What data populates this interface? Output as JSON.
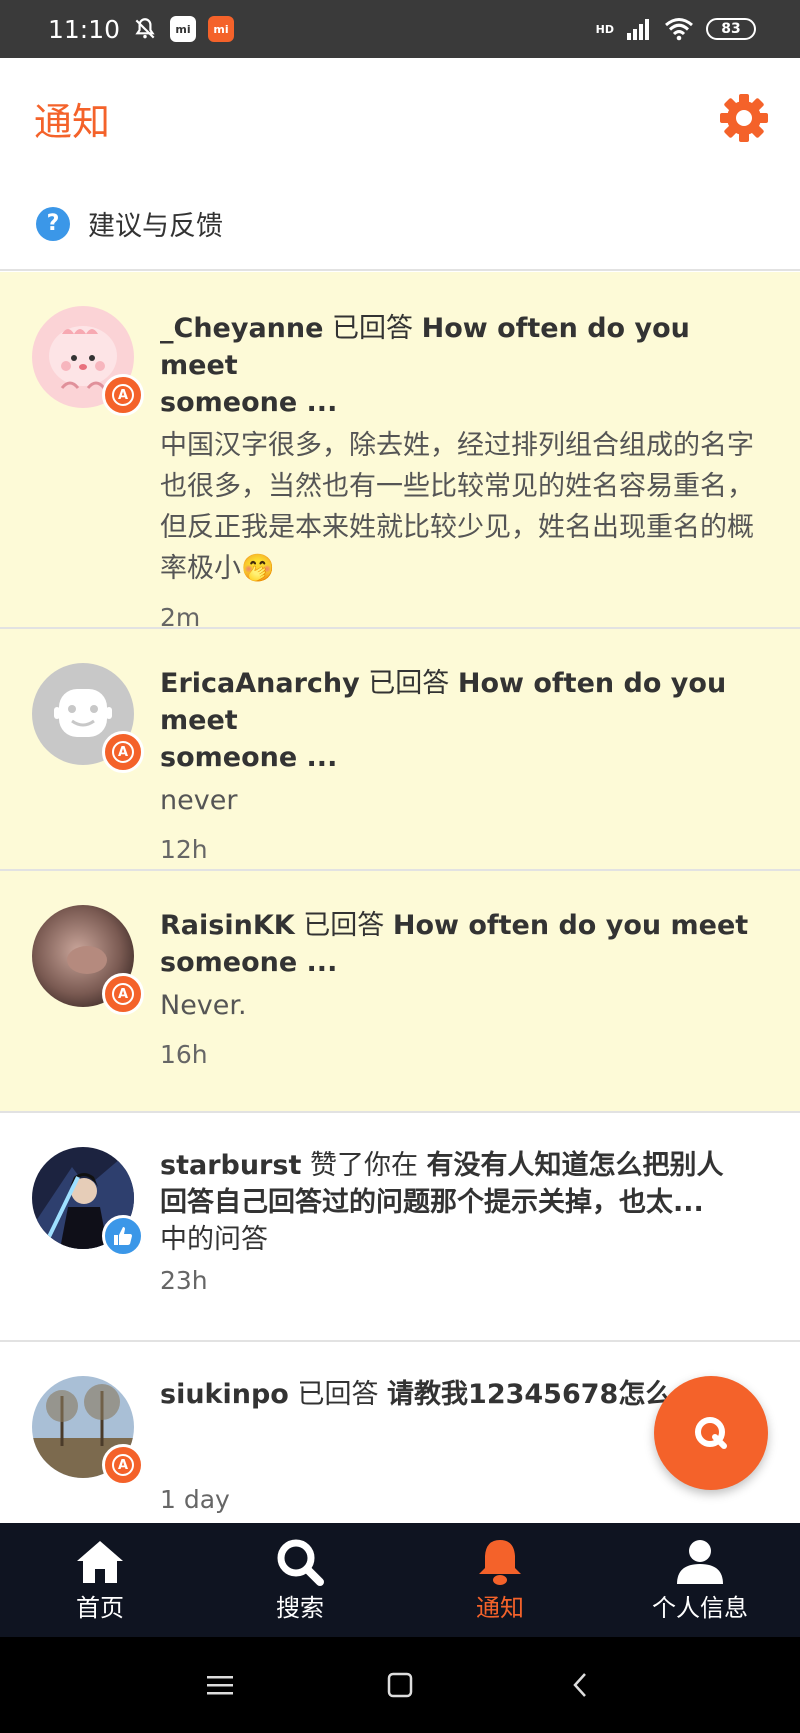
{
  "status_bar": {
    "time": "11:10",
    "battery": "83",
    "network": "HD"
  },
  "header": {
    "title": "通知"
  },
  "feedback": {
    "label": "建议与反馈"
  },
  "notifications": [
    {
      "user": "_Cheyanne",
      "action": " 已回答 ",
      "target_line1": "How often do you meet",
      "target_line2": "someone ...",
      "body": "中国汉字很多，除去姓，经过排列组合组成的名字也很多，当然也有一些比较常见的姓名容易重名，但反正我是本来姓就比较少见，姓名出现重名的概率极小🤭",
      "time": "2m",
      "badge": "answer"
    },
    {
      "user": "EricaAnarchy",
      "action": " 已回答 ",
      "target_line1": "How often do you meet",
      "target_line2": "someone ...",
      "body": "never",
      "time": "12h",
      "badge": "answer"
    },
    {
      "user": "RaisinKK",
      "action": " 已回答 ",
      "target_line1": "How often do you meet",
      "target_line2": "someone ...",
      "body": "Never.",
      "time": "16h",
      "badge": "answer"
    },
    {
      "user": "starburst",
      "action": " 赞了你在 ",
      "target_line1": "有没有人知道怎么把别人",
      "target_line2": "回答自己回答过的问题那个提示关掉，也太...",
      "suffix": "中的问答",
      "time": "23h",
      "badge": "like"
    },
    {
      "user": "siukinpo",
      "action": " 已回答 ",
      "target_line1": "请教我12345678怎么",
      "time": "1 day",
      "badge": "answer"
    }
  ],
  "bottom_nav": {
    "items": [
      {
        "label": "首页",
        "icon": "home-icon"
      },
      {
        "label": "搜索",
        "icon": "search-icon"
      },
      {
        "label": "通知",
        "icon": "bell-icon",
        "active": true
      },
      {
        "label": "个人信息",
        "icon": "profile-icon"
      }
    ]
  },
  "colors": {
    "accent": "#f4622a",
    "unread_bg": "#fdfad7",
    "nav_bg": "#0f1421",
    "link_blue": "#3b97e8"
  }
}
